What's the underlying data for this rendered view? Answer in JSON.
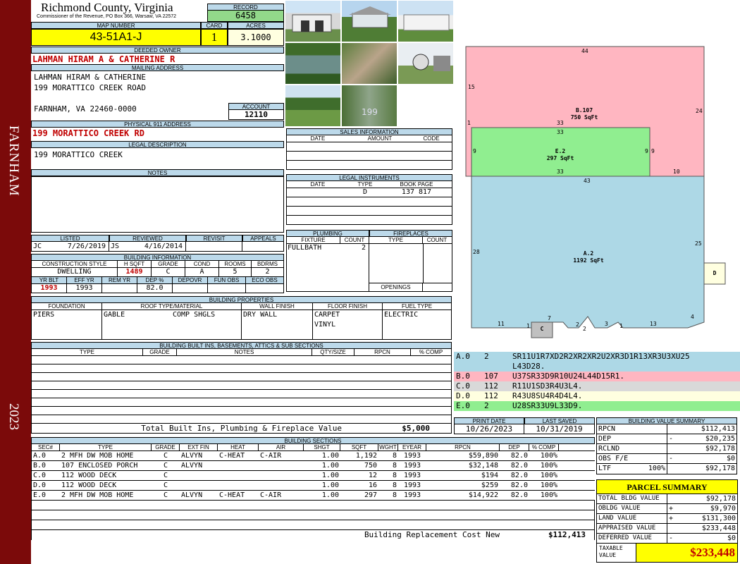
{
  "side_banner": {
    "district": "FARNHAM",
    "year": "2023",
    "color": "#7b0a0a"
  },
  "header": {
    "county": "Richmond County, Virginia",
    "commissioner": "Commissioner of the Revenue, PO Box 366, Warsaw, VA 22572",
    "record_label": "RECORD",
    "record": "6458",
    "map_label": "MAP NUMBER",
    "map_number": "43-51A1-J",
    "card_label": "CARD",
    "card": "1",
    "acres_label": "ACRES",
    "acres": "3.1000"
  },
  "owner": {
    "deeded_label": "DEEDED OWNER",
    "deeded_owner": "LAHMAN HIRAM A & CATHERINE R",
    "mailing_label": "MAILING ADDRESS",
    "mailing_line1": "LAHMAN HIRAM & CATHERINE",
    "mailing_line2": "199 MORATTICO CREEK ROAD",
    "mailing_line3": "FARNHAM, VA 22460-0000",
    "account_label": "ACCOUNT",
    "account": "12110",
    "physical_label": "PHYSICAL 911 ADDRESS",
    "physical": "199 MORATTICO CREEK RD",
    "legal_label": "LEGAL DESCRIPTION",
    "legal": "199 MORATTICO CREEK",
    "notes_label": "NOTES"
  },
  "sales": {
    "title": "SALES INFORMATION",
    "headers": [
      "DATE",
      "AMOUNT",
      "CODE"
    ]
  },
  "legal_instruments": {
    "title": "LEGAL INSTRUMENTS",
    "headers": [
      "DATE",
      "TYPE",
      "BOOK PAGE"
    ],
    "rows": [
      {
        "date": "",
        "type": "D",
        "bookpage": "137 817"
      }
    ]
  },
  "listing": {
    "listed_label": "LISTED",
    "listed_by": "JC",
    "listed_date": "7/26/2019",
    "reviewed_label": "REVIEWED",
    "reviewed_by": "JS",
    "reviewed_date": "4/16/2014",
    "revisit_label": "REVISIT",
    "appeals_label": "APPEALS"
  },
  "building_info": {
    "title": "BUILDING INFORMATION",
    "headers1": [
      "CONSTRUCTION STYLE",
      "H SQFT",
      "GRADE",
      "COND",
      "ROOMS",
      "BDRMS"
    ],
    "values1": [
      "DWELLING",
      "1489",
      "C",
      "A",
      "5",
      "2"
    ],
    "headers2": [
      "YR BLT",
      "EFF YR",
      "REM YR",
      "DEP %",
      "DEPOVR",
      "FUN OBS",
      "ECO OBS"
    ],
    "values2": [
      "1993",
      "1993",
      "",
      "82.0",
      "",
      "",
      ""
    ]
  },
  "plumbing": {
    "title": "PLUMBING",
    "headers": [
      "FIXTURE",
      "COUNT"
    ],
    "rows": [
      {
        "fixture": "FULLBATH",
        "count": "2"
      }
    ]
  },
  "fireplaces": {
    "title": "FIREPLACES",
    "headers": [
      "TYPE",
      "COUNT"
    ],
    "openings_label": "OPENINGS"
  },
  "building_properties": {
    "title": "BUILDING PROPERTIES",
    "headers": [
      "FOUNDATION",
      "ROOF TYPE/MATERIAL",
      "WALL FINISH",
      "FLOOR FINISH",
      "FUEL TYPE"
    ],
    "foundation": "PIERS",
    "roof_type": "GABLE",
    "roof_material": "COMP SHGLS",
    "wall": "DRY WALL",
    "floor1": "CARPET",
    "floor2": "VINYL",
    "fuel": "ELECTRIC"
  },
  "built_ins": {
    "title": "BUILDING BUILT INS, BASEMENTS, ATTICS & SUB SECTIONS",
    "headers": [
      "TYPE",
      "GRADE",
      "NOTES",
      "QTY/SIZE",
      "RPCN",
      "% COMP"
    ],
    "total_label": "Total Built Ins, Plumbing & Fireplace Value",
    "total_value": "$5,000"
  },
  "print": {
    "print_label": "PRINT DATE",
    "print_date": "10/26/2023",
    "saved_label": "LAST SAVED",
    "saved_date": "10/31/2019"
  },
  "sketch": {
    "areas": [
      {
        "code": "B.107",
        "sqft": "750 SqFt",
        "color": "#ffb6c1"
      },
      {
        "code": "E.2",
        "sqft": "297 SqFt",
        "color": "#90ee90"
      },
      {
        "code": "A.2",
        "sqft": "1192 SqFt",
        "color": "#add8e6"
      },
      {
        "code": "C",
        "color": "#c0c0c0"
      },
      {
        "code": "D",
        "color": "#ffffe0"
      }
    ],
    "dims": {
      "b_top": "44",
      "b_left": "15",
      "b_right": "24",
      "b_bottom": "33",
      "b_one": "1",
      "b_ten": "10",
      "e_top": "33",
      "e_left": "9",
      "e_right": "9",
      "e_right2": "9",
      "e_bottom": "33",
      "a_top": "43",
      "a_left": "28",
      "a_right": "25",
      "a_b1": "11",
      "a_b2": "1",
      "a_b3": "7",
      "a_b4": "2",
      "a_b5": "2",
      "a_b6": "3",
      "a_b7": "1",
      "a_b8": "13",
      "a_b9": "4"
    }
  },
  "sequences": [
    {
      "id": "A.0",
      "code": "2",
      "vectors": "SR11U1R7XD2R2XR2XR2U2XR3D1R13XR3U3XU25",
      "vectors2": "L43D28.",
      "color": "#add8e6"
    },
    {
      "id": "B.0",
      "code": "107",
      "vectors": "U37SR33D9R10U24L44D15R1.",
      "color": "#ffb6c1"
    },
    {
      "id": "C.0",
      "code": "112",
      "vectors": "R11U1SD3R4U3L4.",
      "color": "#d9d9d9"
    },
    {
      "id": "D.0",
      "code": "112",
      "vectors": "R43U8SU4R4D4L4.",
      "color": "#ffffe0"
    },
    {
      "id": "E.0",
      "code": "2",
      "vectors": "U28SR33U9L33D9.",
      "color": "#90ee90"
    }
  ],
  "sections": {
    "title": "BUILDING SECTIONS",
    "headers": [
      "SEC#",
      "TYPE",
      "GRADE",
      "EXT FIN",
      "HEAT",
      "AIR",
      "SHGT",
      "SQFT",
      "WGHT",
      "EYEAR",
      "RPCN",
      "DEP",
      "% COMP"
    ],
    "rows": [
      [
        "A.0",
        "2 MFH DW MOB HOME",
        "C",
        "ALVYN",
        "C-HEAT",
        "C-AIR",
        "1.00",
        "1,192",
        "8",
        "1993",
        "$59,890",
        "82.0",
        "100%"
      ],
      [
        "B.0",
        "107 ENCLOSED PORCH",
        "C",
        "ALVYN",
        "",
        "",
        "1.00",
        "750",
        "8",
        "1993",
        "$32,148",
        "82.0",
        "100%"
      ],
      [
        "C.0",
        "112 WOOD DECK",
        "C",
        "",
        "",
        "",
        "1.00",
        "12",
        "8",
        "1993",
        "$194",
        "82.0",
        "100%"
      ],
      [
        "D.0",
        "112 WOOD DECK",
        "C",
        "",
        "",
        "",
        "1.00",
        "16",
        "8",
        "1993",
        "$259",
        "82.0",
        "100%"
      ],
      [
        "E.0",
        "2 MFH DW MOB HOME",
        "C",
        "ALVYN",
        "C-HEAT",
        "C-AIR",
        "1.00",
        "297",
        "8",
        "1993",
        "$14,922",
        "82.0",
        "100%"
      ]
    ],
    "replacement_label": "Building Replacement Cost New",
    "replacement_value": "$112,413"
  },
  "value_summary": {
    "title": "BUILDING VALUE SUMMARY",
    "rows": [
      {
        "label": "RPCN",
        "op": "",
        "value": "$112,413"
      },
      {
        "label": "DEP",
        "op": "-",
        "value": "$20,235"
      },
      {
        "label": "RCLND",
        "op": "",
        "value": "$92,178"
      },
      {
        "label": "OBS F/E",
        "op": "-",
        "value": "$0"
      },
      {
        "label": "LTF",
        "pct": "100%",
        "op": "",
        "value": "$92,178"
      }
    ]
  },
  "parcel_summary": {
    "title": "PARCEL SUMMARY",
    "rows": [
      {
        "label": "TOTAL BLDG VALUE",
        "op": "",
        "value": "$92,178"
      },
      {
        "label": "OBLDG VALUE",
        "op": "+",
        "value": "$9,970"
      },
      {
        "label": "LAND VALUE",
        "op": "+",
        "value": "$131,300"
      },
      {
        "label": "APPRAISED VALUE",
        "op": "",
        "value": "$233,448"
      },
      {
        "label": "DEFERRED VALUE",
        "op": "-",
        "value": "$0"
      }
    ],
    "taxable_label": "TAXABLE VALUE",
    "taxable_value": "$233,448"
  }
}
